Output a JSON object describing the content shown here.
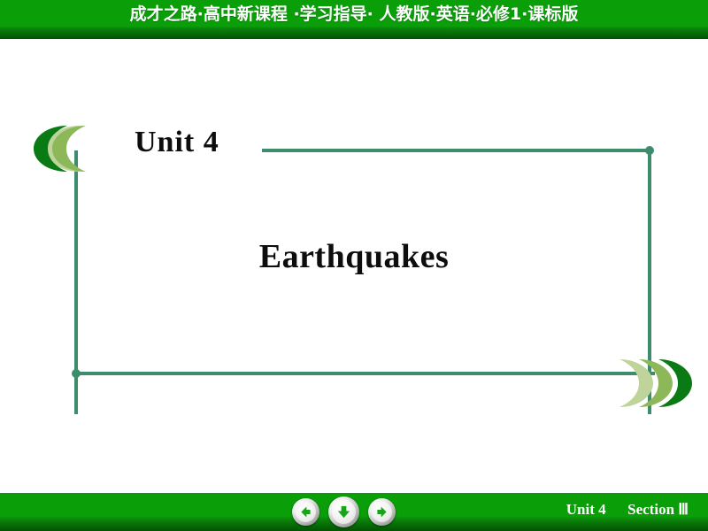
{
  "header": {
    "title": "成才之路·高中新课程 ·学习指导· 人教版·英语·必修1·课标版",
    "background_color": "#0a9e09",
    "text_color": "#ffffff"
  },
  "slide": {
    "unit_label": "Unit 4",
    "lesson_title": "Earthquakes",
    "text_color": "#0d0d0d",
    "frame_color": "#3d8c6b",
    "background_color": "#ffffff"
  },
  "decor": {
    "left_cluster": {
      "name": "triple-crescent-left",
      "direction": "left",
      "colors": [
        "#0a7a14",
        "#8cb85a",
        "#bed49a"
      ]
    },
    "right_cluster": {
      "name": "triple-crescent-right",
      "direction": "right",
      "colors": [
        "#bed49a",
        "#8cb85a",
        "#0a7a14"
      ]
    }
  },
  "footer": {
    "background_color": "#0a9e09",
    "unit_label": "Unit 4",
    "section_label": "Section Ⅲ",
    "nav": [
      {
        "name": "back-button",
        "icon": "arrow-left-icon",
        "arrow_color": "#18a318"
      },
      {
        "name": "down-button",
        "icon": "arrow-down-icon",
        "arrow_color": "#18a318"
      },
      {
        "name": "forward-button",
        "icon": "arrow-right-icon",
        "arrow_color": "#18a318"
      }
    ]
  }
}
